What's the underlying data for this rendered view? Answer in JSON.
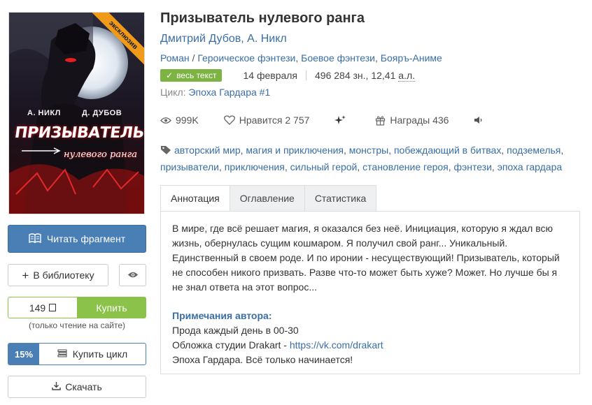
{
  "cover": {
    "badge": "эксклюзив",
    "author_left": "А. НИКЛ",
    "author_right": "Д. ДУБОВ",
    "title": "ПРИЗЫВАТЕЛЬ",
    "subtitle": "нулевого ранга"
  },
  "sidebar": {
    "read_label": "Читать фрагмент",
    "library_label": "В библиотеку",
    "price": "149",
    "buy_label": "Купить",
    "buy_note": "(только чтение на сайте)",
    "cycle_discount": "15%",
    "cycle_buy_label": "Купить цикл",
    "download_label": "Скачать"
  },
  "book": {
    "title": "Призыватель нулевого ранга",
    "authors": [
      "Дмитрий Дубов",
      "А. Никл"
    ],
    "author_sep": ", ",
    "genres": [
      "Роман",
      "Героическое фэнтези",
      "Боевое фэнтези",
      "Бояръ-Аниме"
    ],
    "status_badge": "весь текст",
    "date": "14 февраля",
    "size": "496 284 зн., 12,41",
    "size_unit": "а.л.",
    "cycle_label": "Цикл:",
    "cycle_name": "Эпоха Гардара #1"
  },
  "stats": {
    "views": "999K",
    "likes": "Нравится 2 757",
    "awards": "Награды 436"
  },
  "tags": [
    "авторский мир",
    "магия и приключения",
    "монстры",
    "побеждающий в битвах",
    "подземелья",
    "призыватели",
    "приключения",
    "сильный герой",
    "становление героя",
    "фэнтези",
    "эпоха гардара"
  ],
  "tabs": [
    {
      "label": "Аннотация",
      "active": true
    },
    {
      "label": "Оглавление",
      "active": false
    },
    {
      "label": "Статистика",
      "active": false
    }
  ],
  "annotation": {
    "text": "В мире, где всё решает магия, я оказался без неё. Инициация, которую я ждал всю жизнь, обернулась сущим кошмаром. Я получил свой ранг... Уникальный. Единственный в своем роде. И по иронии - несуществующий! Призыватель, который не способен никого призвать. Разве что-то может быть хуже? Может. Но лучше бы я не знал ответа на этот вопрос...",
    "notes_title": "Примечания автора:",
    "note_1": "Прода каждый день в 00-30",
    "note_2_prefix": "Обложка студии Drakart - ",
    "note_2_link": "https://vk.com/drakart",
    "note_3": "Эпоха Гардара. Всё только начинается!"
  }
}
